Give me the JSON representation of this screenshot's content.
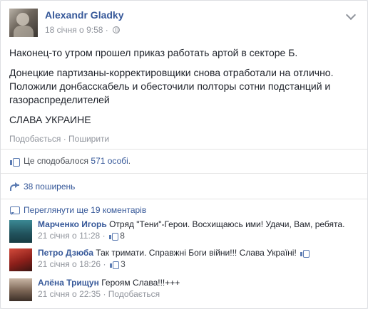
{
  "post": {
    "author": "Alexandr Gladky",
    "timestamp": "18 січня о 9:58",
    "separator": "·",
    "privacy_icon": "globe-icon",
    "paragraphs": [
      "Наконец-то утром прошел приказ работать артой в секторе Б.",
      "Донецкие партизаны-корректировщики снова отработали на отлично. Положили донбасскабель и обесточили полторы сотни подстанций и газораспределителей",
      "СЛАВА УКРАИНЕ"
    ],
    "actions": {
      "like": "Подобається",
      "dot": "·",
      "share": "Поширити"
    }
  },
  "summary": {
    "likes_text": "Це сподобалося",
    "likes_count": "571 особі",
    "likes_end": ".",
    "shares": "38 поширень",
    "more_comments": "Переглянути ще 19 коментарів"
  },
  "comments": [
    {
      "author": "Марченко Игорь",
      "text": "Отряд \"Тени\"-Герои. Восхищаюсь ими! Удачи, Вам, ребята.",
      "time": "21 січня о 11:28",
      "dot": "·",
      "likes": "8",
      "avatar_color": "#2d6e78"
    },
    {
      "author": "Петро Дзюба",
      "text": "Так тримати. Справжні Боги війни!!! Слава Україні!",
      "time": "21 січня о 18:26",
      "dot": "·",
      "likes": "3",
      "avatar_color": "#b8322c"
    },
    {
      "author": "Алёна Трищун",
      "text": "Героям Слава!!!+++",
      "time": "21 січня о 22:35",
      "dot": "·",
      "like_label": "Подобається",
      "avatar_color": "#6f5a4b"
    }
  ]
}
